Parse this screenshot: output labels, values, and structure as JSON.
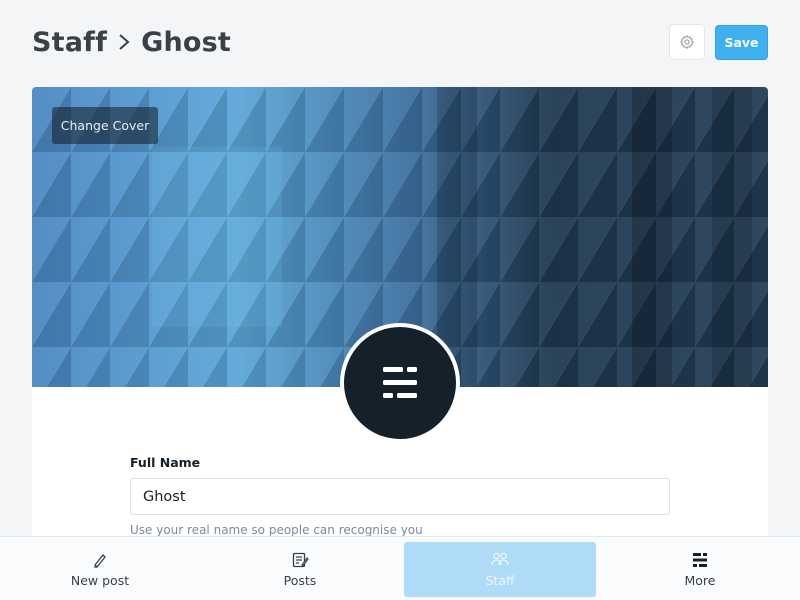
{
  "breadcrumb": {
    "parent": "Staff",
    "current": "Ghost"
  },
  "toolbar": {
    "settings_icon": "gear-icon",
    "save_label": "Save"
  },
  "cover": {
    "change_label": "Change Cover"
  },
  "avatar": {
    "icon": "ghost-logo-icon"
  },
  "form": {
    "full_name_label": "Full Name",
    "full_name_value": "Ghost",
    "full_name_hint": "Use your real name so people can recognise you"
  },
  "bottom_nav": {
    "items": [
      {
        "label": "New post",
        "icon": "pen-icon"
      },
      {
        "label": "Posts",
        "icon": "posts-icon"
      },
      {
        "label": "Staff",
        "icon": "staff-icon",
        "active": true
      },
      {
        "label": "More",
        "icon": "more-icon"
      }
    ]
  },
  "colors": {
    "accent": "#3eb0ef",
    "active_nav": "#aedbf6",
    "avatar_bg": "#15212a"
  }
}
